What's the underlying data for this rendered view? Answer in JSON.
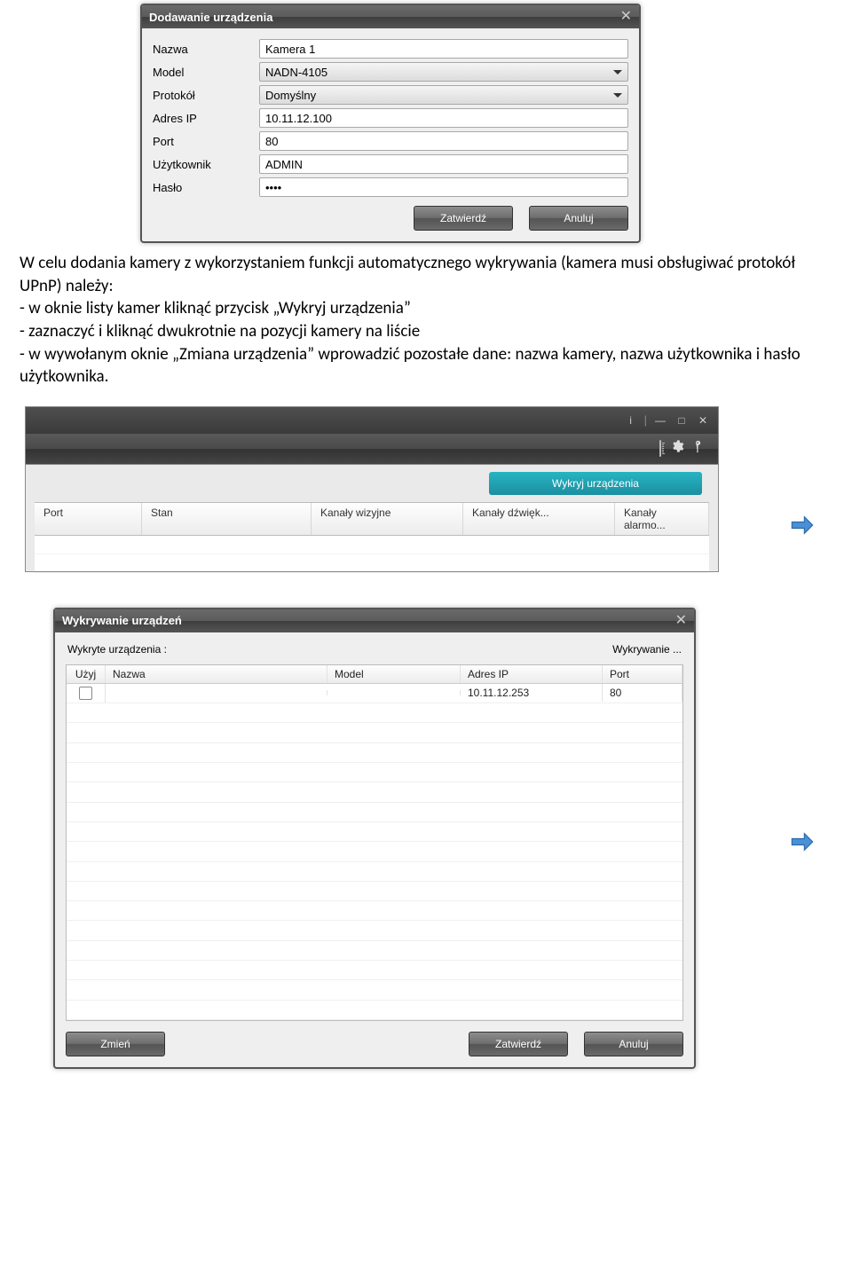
{
  "dialog1": {
    "title": "Dodawanie urządzenia",
    "fields": {
      "name_label": "Nazwa",
      "name_value": "Kamera 1",
      "model_label": "Model",
      "model_value": "NADN-4105",
      "protocol_label": "Protokół",
      "protocol_value": "Domyślny",
      "ip_label": "Adres IP",
      "ip_value": "10.11.12.100",
      "port_label": "Port",
      "port_value": "80",
      "user_label": "Użytkownik",
      "user_value": "ADMIN",
      "password_label": "Hasło",
      "password_value": "••••"
    },
    "buttons": {
      "ok": "Zatwierdź",
      "cancel": "Anuluj"
    }
  },
  "paragraph": "W celu dodania kamery z wykorzystaniem funkcji automatycznego wykrywania (kamera musi obsługiwać protokół UPnP) należy:\n- w oknie listy kamer kliknąć przycisk „Wykryj urządzenia”\n- zaznaczyć i kliknąć dwukrotnie na pozycji kamery na liście\n- w wywołanym oknie „Zmiana urządzenia” wprowadzić pozostałe dane: nazwa kamery, nazwa użytkownika i hasło użytkownika.",
  "app": {
    "discover_btn": "Wykryj urządzenia",
    "columns": {
      "port": "Port",
      "status": "Stan",
      "video_ch": "Kanały wizyjne",
      "audio_ch": "Kanały dźwięk...",
      "alarm_ch": "Kanały alarmo..."
    }
  },
  "dialog3": {
    "title": "Wykrywanie urządzeń",
    "detected_label": "Wykryte urządzenia :",
    "status_label": "Wykrywanie ...",
    "columns": {
      "use": "Użyj",
      "name": "Nazwa",
      "model": "Model",
      "ip": "Adres IP",
      "port": "Port"
    },
    "rows": [
      {
        "use": false,
        "name": "",
        "model": "",
        "ip": "10.11.12.253",
        "port": "80"
      }
    ],
    "buttons": {
      "edit": "Zmień",
      "ok": "Zatwierdź",
      "cancel": "Anuluj"
    }
  }
}
